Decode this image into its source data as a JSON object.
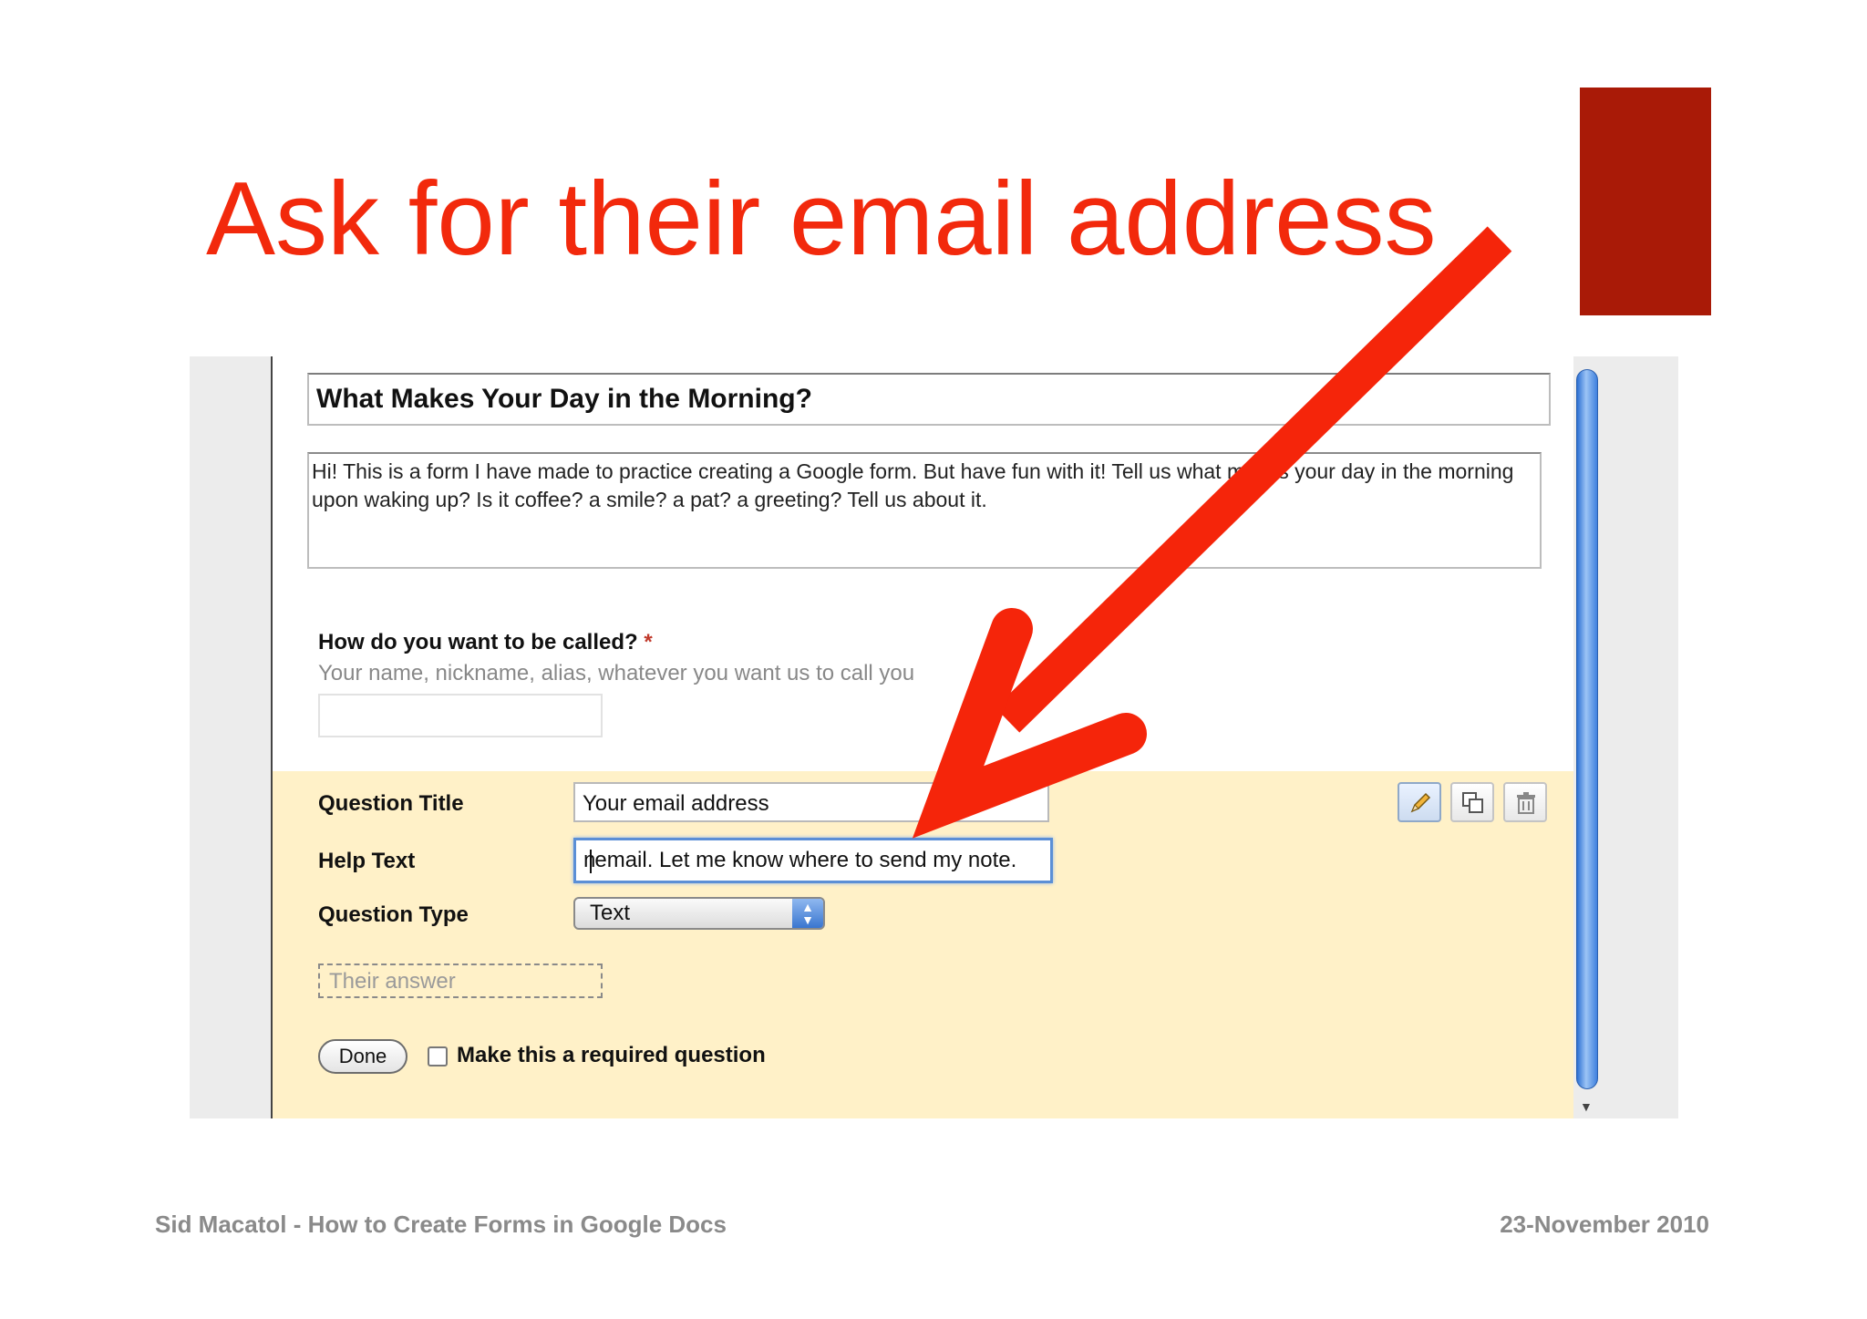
{
  "slide": {
    "title": "Ask for their email address",
    "footer_left": "Sid Macatol - How to Create Forms in Google Docs",
    "footer_right": "23-November 2010",
    "accent_color": "#f2290c",
    "block_color": "#a91a07"
  },
  "form": {
    "title": "What Makes Your Day in the Morning?",
    "description": "Hi! This is a form I have made to practice creating a Google form. But have fun with it! Tell us what makes your day in the morning upon waking up? Is it coffee? a smile? a pat? a greeting? Tell us about it.",
    "question1": {
      "title": "How do you want to be called?",
      "required_mark": "*",
      "help": "Your name, nickname, alias, whatever you want us to call you"
    }
  },
  "editor": {
    "question_title_label": "Question Title",
    "question_title_value": "Your email address",
    "help_text_label": "Help Text",
    "help_text_value_left": "n",
    "help_text_value_right": "email. Let me know where to send my note.",
    "question_type_label": "Question Type",
    "question_type_value": "Text",
    "answer_placeholder": "Their answer",
    "done_label": "Done",
    "required_label": "Make this a required question",
    "required_checked": false,
    "tools": [
      "pencil-icon",
      "duplicate-icon",
      "trash-icon"
    ]
  }
}
